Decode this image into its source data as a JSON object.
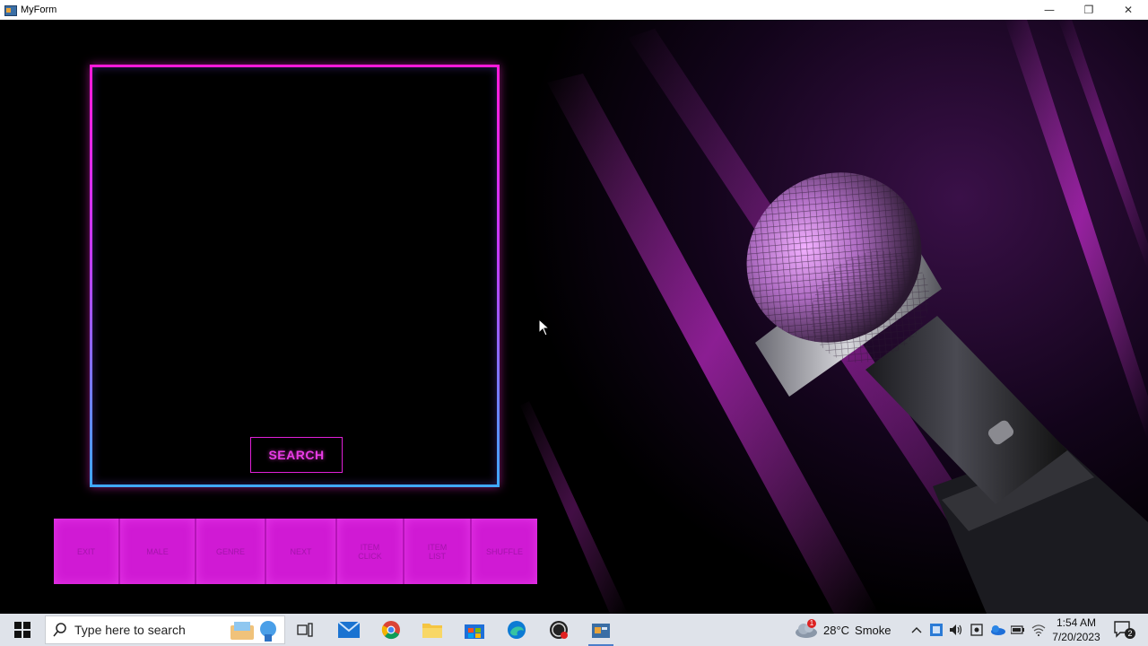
{
  "window": {
    "title": "MyForm",
    "controls": {
      "minimize": "—",
      "restore": "❐",
      "close": "✕"
    }
  },
  "panel": {
    "search_button": "SEARCH",
    "accent_top": "#ff1ad9",
    "accent_bottom": "#3fa9ff"
  },
  "buttons": [
    {
      "label": "EXIT"
    },
    {
      "label": "MALE"
    },
    {
      "label": "GENRE"
    },
    {
      "label": "NEXT"
    },
    {
      "label": "ITEM\nCLICK"
    },
    {
      "label": "ITEM\nLIST"
    },
    {
      "label": "SHUFFLE"
    }
  ],
  "taskbar": {
    "search_placeholder": "Type here to search",
    "weather": {
      "temperature": "28°C",
      "condition": "Smoke",
      "badge": "1"
    },
    "clock": {
      "time": "1:54 AM",
      "date": "7/20/2023"
    },
    "notification_count": "2",
    "pinned": [
      "task-view",
      "mail",
      "chrome",
      "file-explorer",
      "store",
      "edge",
      "obs",
      "app"
    ]
  }
}
